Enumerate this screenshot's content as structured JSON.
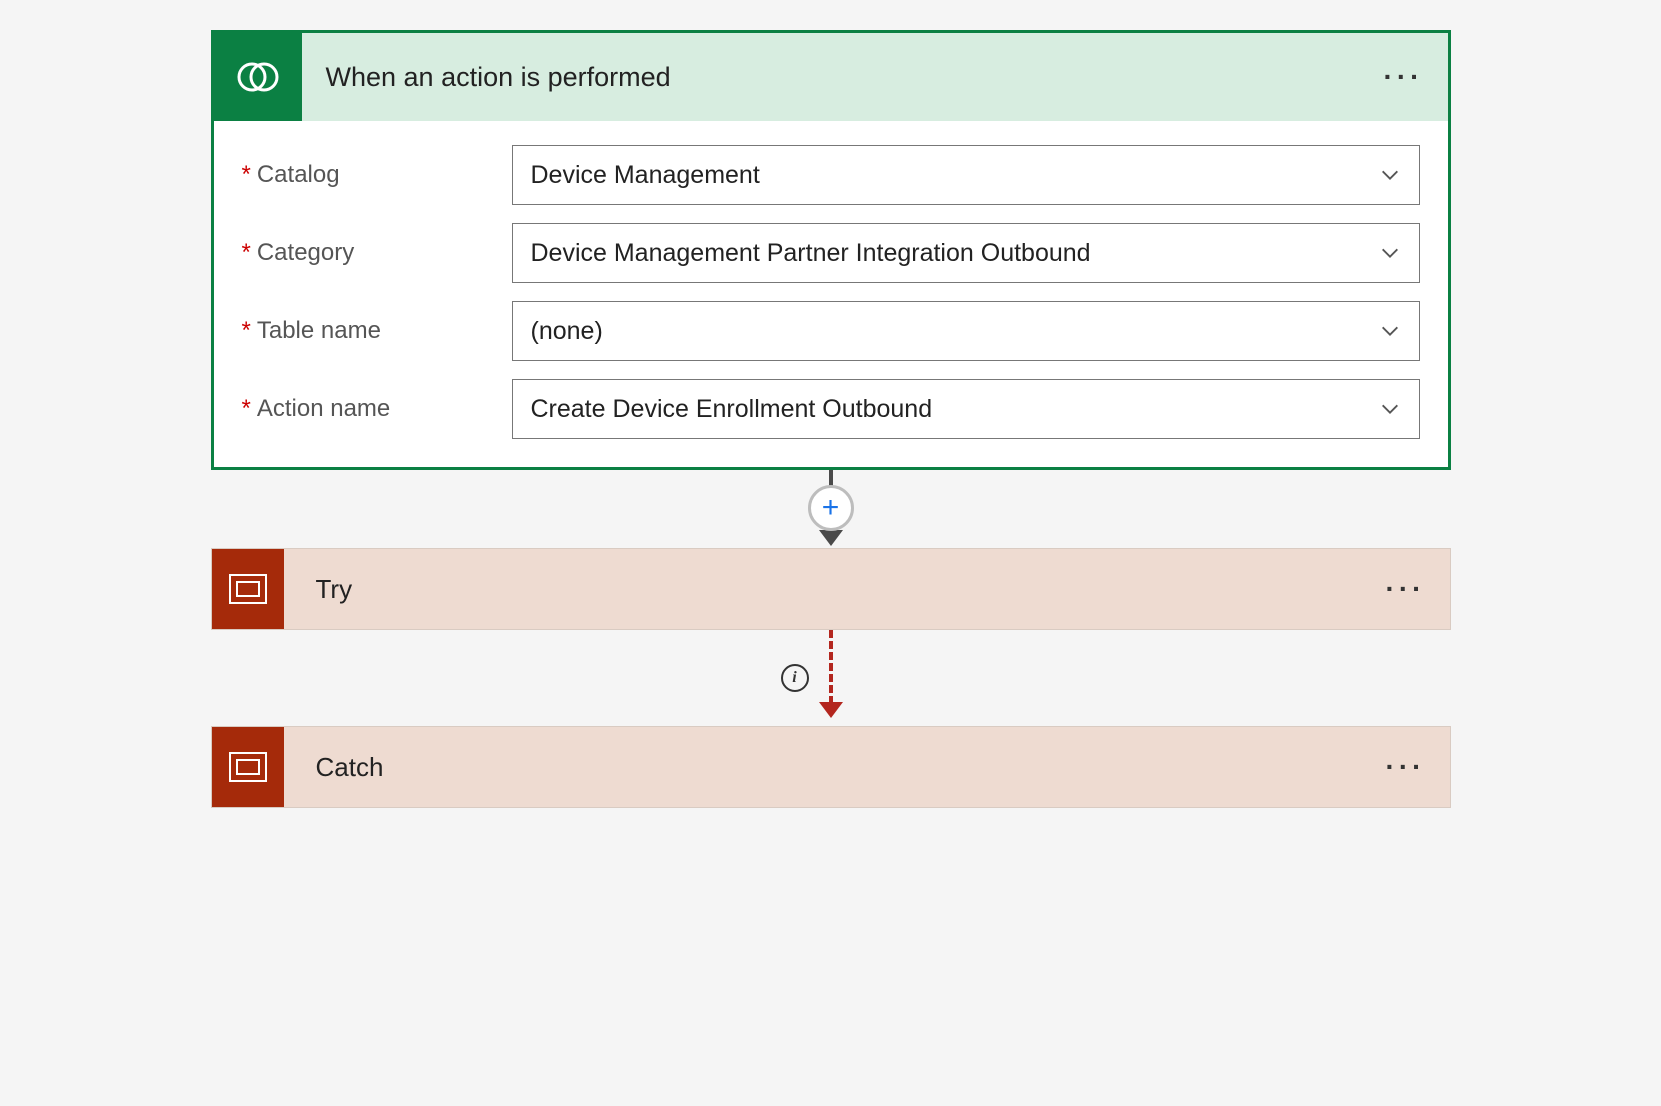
{
  "trigger": {
    "title": "When an action is performed",
    "fields": {
      "catalog": {
        "label": "Catalog",
        "value": "Device Management"
      },
      "category": {
        "label": "Category",
        "value": "Device Management Partner Integration Outbound"
      },
      "tablename": {
        "label": "Table name",
        "value": "(none)"
      },
      "actionname": {
        "label": "Action name",
        "value": "Create Device Enrollment Outbound"
      }
    }
  },
  "steps": {
    "try": {
      "title": "Try"
    },
    "catch": {
      "title": "Catch"
    }
  },
  "glyphs": {
    "plus": "+",
    "info": "i"
  }
}
